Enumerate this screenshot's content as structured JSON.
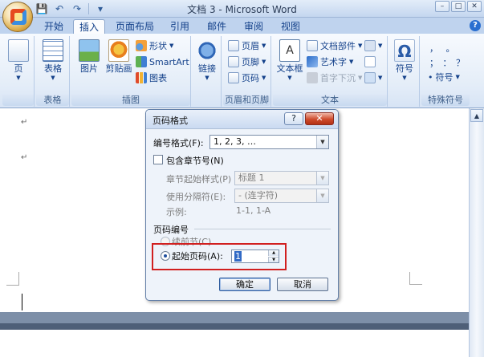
{
  "window": {
    "title": "文档 3 - Microsoft Word",
    "min": "–",
    "max": "□",
    "close": "✕"
  },
  "qat": {
    "save": "💾",
    "undo": "↶",
    "redo": "↷",
    "more": "▾"
  },
  "tabs": [
    {
      "label": "开始"
    },
    {
      "label": "插入",
      "active": true
    },
    {
      "label": "页面布局"
    },
    {
      "label": "引用"
    },
    {
      "label": "邮件"
    },
    {
      "label": "审阅"
    },
    {
      "label": "视图"
    }
  ],
  "ribbon": {
    "pages": {
      "group_label": "",
      "btn": "页"
    },
    "table": {
      "group_label": "表格",
      "btn": "表格"
    },
    "illustrations": {
      "group_label": "插图",
      "picture": "图片",
      "clipart": "剪贴画",
      "shapes": "形状",
      "smartart": "SmartArt",
      "chart": "图表"
    },
    "links": {
      "btn": "链接"
    },
    "header_footer": {
      "group_label": "页眉和页脚",
      "header": "页眉",
      "footer": "页脚",
      "page_number": "页码"
    },
    "text": {
      "group_label": "文本",
      "textbox": "文本框",
      "quickparts": "文档部件",
      "wordart": "艺术字",
      "dropcap": "首字下沉"
    },
    "symbols": {
      "group_label": "特殊符号",
      "symbol": "符号",
      "special": "符号",
      "dots1": "，  。",
      "dots2": "；  ：  ？"
    }
  },
  "document": {
    "para_mark": "↵"
  },
  "dialog": {
    "title": "页码格式",
    "help": "?",
    "close": "✕",
    "number_format_label": "编号格式(F):",
    "number_format_value": "1, 2, 3, …",
    "include_chapter_label": "包含章节号(N)",
    "chapter_style_label": "章节起始样式(P)",
    "chapter_style_value": "标题 1",
    "separator_label": "使用分隔符(E):",
    "separator_value": "-    (连字符)",
    "example_label": "示例:",
    "example_value": "1-1, 1-A",
    "numbering_section_label": "页码编号",
    "continue_label": "续前节(C)",
    "start_at_label": "起始页码(A):",
    "start_at_value": "1",
    "ok": "确定",
    "cancel": "取消"
  }
}
